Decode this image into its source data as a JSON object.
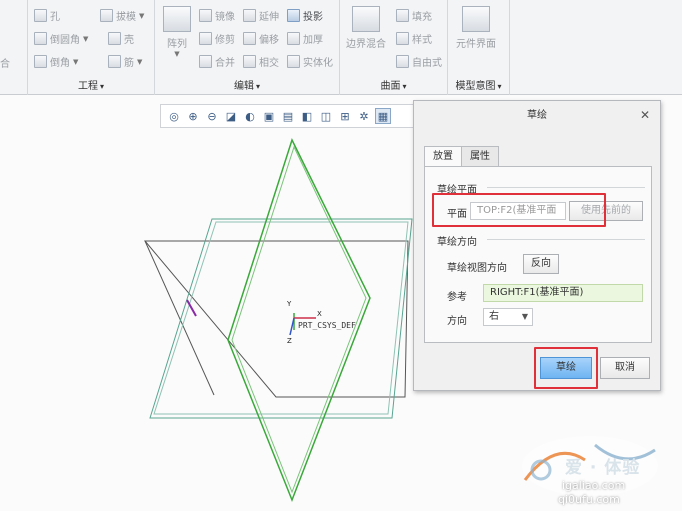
{
  "ribbon": {
    "groups": {
      "engineering": "工程",
      "editing": "编辑",
      "surface": "曲面",
      "model_intent": "模型意图"
    },
    "items": {
      "hole": "孔",
      "draft": "拔模",
      "round": "倒圆角",
      "shell": "壳",
      "chamfer": "倒角",
      "rib": "筋",
      "pattern": "阵列",
      "mirror": "镜像",
      "extend": "延伸",
      "project": "投影",
      "trim": "修剪",
      "offset": "偏移",
      "thicken": "加厚",
      "merge": "合并",
      "intersect": "相交",
      "solidify": "实体化",
      "boundary_blend": "边界混合",
      "fill": "填充",
      "style": "样式",
      "freestyle": "自由式",
      "component_interface": "元件界面",
      "left_partial_1": "合"
    }
  },
  "dialog": {
    "title": "草绘",
    "tabs": [
      "放置",
      "属性"
    ],
    "sketch_plane_section": "草绘平面",
    "plane_label": "平面",
    "plane_value": "TOP:F2(基准平面",
    "use_previous_button": "使用先前的",
    "sketch_orientation_section": "草绘方向",
    "view_direction_label": "草绘视图方向",
    "flip_button": "反向",
    "reference_label": "参考",
    "reference_value": "RIGHT:F1(基准平面)",
    "orientation_label": "方向",
    "orientation_value": "右",
    "sketch_button": "草绘",
    "cancel_button": "取消"
  },
  "canvas": {
    "csys_label": "PRT_CSYS_DEF",
    "axis_y": "Y",
    "axis_x": "X",
    "axis_z": "Z"
  },
  "watermark": {
    "brand": "爱 · 体验",
    "url": "igaliao.com",
    "url2": "qi0ufu.com"
  },
  "colors": {
    "highlight_red": "#e0313a",
    "datum_gray": "#555555",
    "sketch_green": "#3aa83a",
    "datum_teal": "#58a58f",
    "primary_button": "#7bbcf5"
  }
}
